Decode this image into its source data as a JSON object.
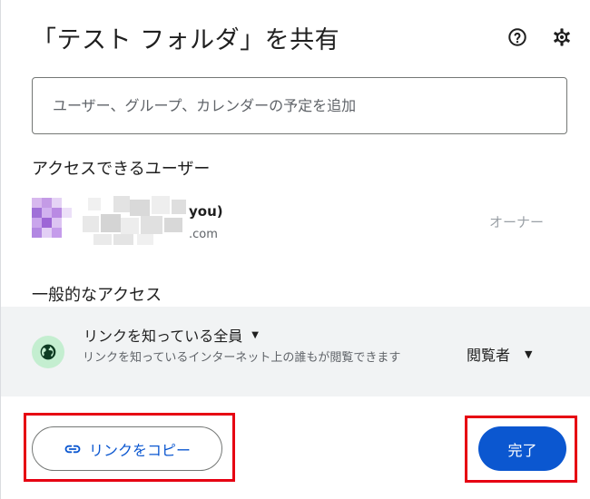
{
  "dialog": {
    "title": "「テスト フォルダ」を共有",
    "help_icon": "help-circle-icon",
    "settings_icon": "gear-icon"
  },
  "add_people": {
    "placeholder": "ユーザー、グループ、カレンダーの予定を追加"
  },
  "people_with_access": {
    "heading": "アクセスできるユーザー",
    "users": [
      {
        "name": "you)",
        "email": ".com",
        "role": "オーナー"
      }
    ]
  },
  "general_access": {
    "heading": "一般的なアクセス",
    "icon": "globe-icon",
    "type": "リンクを知っている全員",
    "description": "リンクを知っているインターネット上の誰もが閲覧できます",
    "role": "閲覧者"
  },
  "footer": {
    "copy_link_label": "リンクをコピー",
    "done_label": "完了"
  },
  "colors": {
    "primary": "#0b57d0",
    "highlight": "#e60012",
    "globe_bg": "#c4eed0",
    "panel_bg": "#f1f3f4"
  }
}
